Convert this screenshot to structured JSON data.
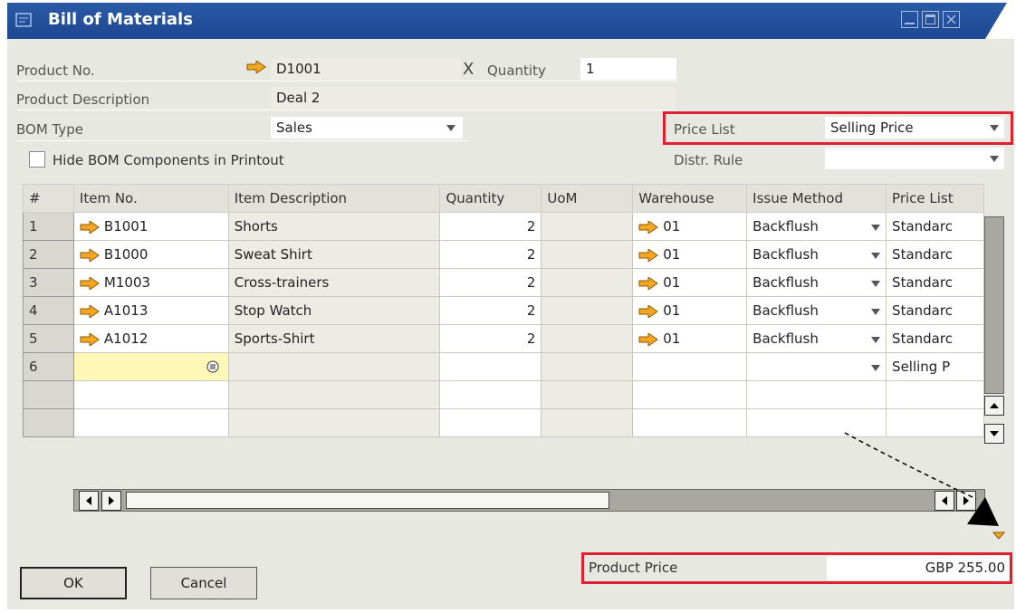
{
  "window": {
    "title": "Bill of Materials"
  },
  "header": {
    "product_no_label": "Product No.",
    "product_no_value": "D1001",
    "x_label": "X",
    "quantity_label": "Quantity",
    "quantity_value": "1",
    "product_desc_label": "Product Description",
    "product_desc_value": "Deal 2",
    "bom_type_label": "BOM Type",
    "bom_type_value": "Sales",
    "price_list_label": "Price List",
    "price_list_value": "Selling Price",
    "distr_rule_label": "Distr. Rule",
    "distr_rule_value": "",
    "hide_bom_label": "Hide BOM Components in Printout",
    "hide_bom_checked": false
  },
  "table": {
    "headers": [
      "#",
      "Item No.",
      "Item Description",
      "Quantity",
      "UoM",
      "Warehouse",
      "Issue Method",
      "Price List"
    ],
    "rows": [
      {
        "n": "1",
        "item": "B1001",
        "desc": "Shorts",
        "qty": "2",
        "uom": "",
        "wh": "01",
        "issue": "Backflush",
        "pl": "Standarc"
      },
      {
        "n": "2",
        "item": "B1000",
        "desc": "Sweat Shirt",
        "qty": "2",
        "uom": "",
        "wh": "01",
        "issue": "Backflush",
        "pl": "Standarc"
      },
      {
        "n": "3",
        "item": "M1003",
        "desc": "Cross-trainers",
        "qty": "2",
        "uom": "",
        "wh": "01",
        "issue": "Backflush",
        "pl": "Standarc"
      },
      {
        "n": "4",
        "item": "A1013",
        "desc": "Stop Watch",
        "qty": "2",
        "uom": "",
        "wh": "01",
        "issue": "Backflush",
        "pl": "Standarc"
      },
      {
        "n": "5",
        "item": "A1012",
        "desc": "Sports-Shirt",
        "qty": "2",
        "uom": "",
        "wh": "01",
        "issue": "Backflush",
        "pl": "Standarc"
      },
      {
        "n": "6",
        "item": "",
        "desc": "",
        "qty": "",
        "uom": "",
        "wh": "",
        "issue": "",
        "pl": "Selling P"
      }
    ]
  },
  "footer": {
    "product_price_label": "Product Price",
    "product_price_value": "GBP 255.00",
    "ok_label": "OK",
    "cancel_label": "Cancel"
  },
  "colors": {
    "title_bar": "#1d4791",
    "highlight": "#e02030",
    "link_arrow": "#f5a623",
    "selected_cell": "#fff7b8"
  },
  "icons": [
    "window-icon",
    "link-arrow-icon",
    "dropdown-icon",
    "list-choose-icon",
    "scroll-left-icon",
    "scroll-right-icon",
    "scroll-up-icon",
    "scroll-down-icon",
    "minimize-icon",
    "maximize-icon",
    "close-icon"
  ]
}
